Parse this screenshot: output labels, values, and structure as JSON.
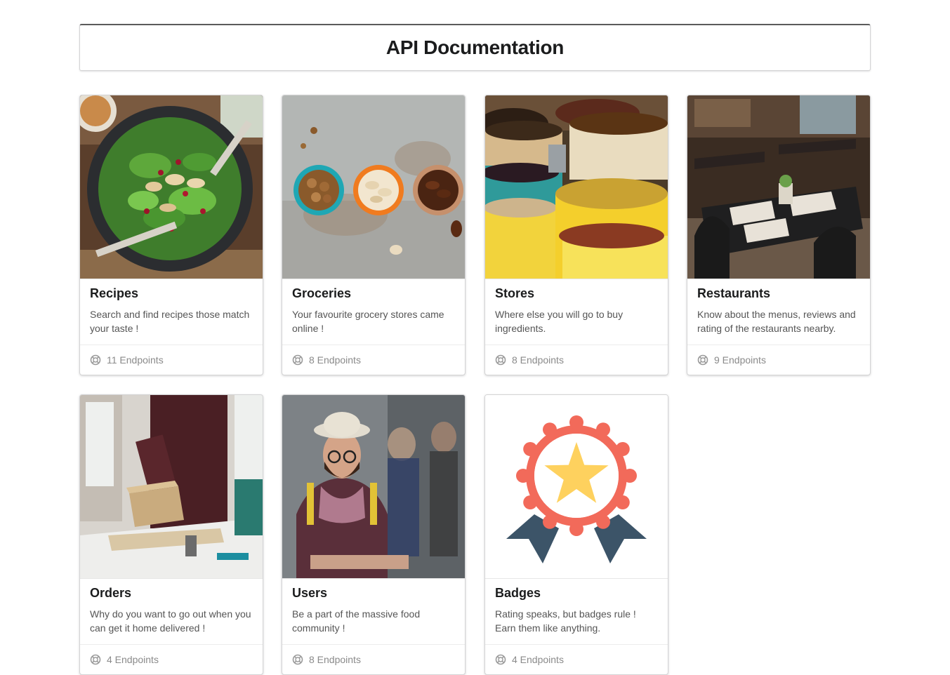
{
  "header": {
    "title": "API Documentation"
  },
  "cards": [
    {
      "title": "Recipes",
      "description": "Search and find recipes those match your taste !",
      "endpoints": "11 Endpoints",
      "image": "salad-bowl-photo"
    },
    {
      "title": "Groceries",
      "description": "Your favourite grocery stores came online !",
      "endpoints": "8 Endpoints",
      "image": "nuts-bowls-photo"
    },
    {
      "title": "Stores",
      "description": "Where else you will go to buy ingredients.",
      "endpoints": "8 Endpoints",
      "image": "grain-sacks-photo"
    },
    {
      "title": "Restaurants",
      "description": "Know about the menus, reviews and rating of the restaurants nearby.",
      "endpoints": "9 Endpoints",
      "image": "restaurant-tables-photo"
    },
    {
      "title": "Orders",
      "description": "Why do you want to go out when you can get it home delivered !",
      "endpoints": "4 Endpoints",
      "image": "parcel-packing-photo"
    },
    {
      "title": "Users",
      "description": "Be a part of the massive food community !",
      "endpoints": "8 Endpoints",
      "image": "man-in-hat-photo"
    },
    {
      "title": "Badges",
      "description": "Rating speaks, but badges rule ! Earn them like anything.",
      "endpoints": "4 Endpoints",
      "image": "star-badge-icon"
    }
  ],
  "icons": {
    "endpoint": "life-ring-icon"
  },
  "colors": {
    "badge_ring": "#f26a5a",
    "badge_star": "#fed15e",
    "badge_ribbon": "#3c5468"
  }
}
